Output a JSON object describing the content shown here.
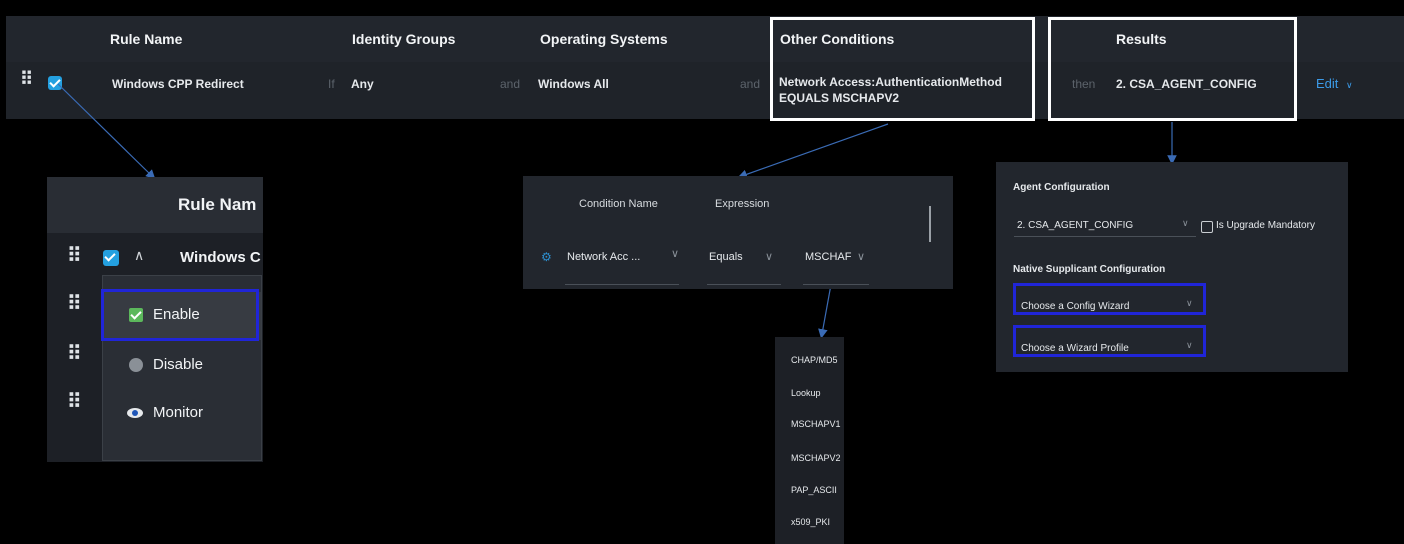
{
  "header": {
    "rule_name": "Rule Name",
    "identity_groups": "Identity Groups",
    "operating_systems": "Operating Systems",
    "other_conditions": "Other Conditions",
    "results": "Results"
  },
  "rule_row": {
    "name": "Windows CPP Redirect",
    "if_label": "If",
    "identity_group": "Any",
    "and1": "and",
    "os": "Windows All",
    "and2": "and",
    "condition_line1": "Network Access:AuthenticationMethod",
    "condition_line2": "EQUALS MSCHAPV2",
    "then_label": "then",
    "result": "2. CSA_AGENT_CONFIG",
    "edit": "Edit",
    "edit_chevron": "∨"
  },
  "rule_menu_panel": {
    "header": "Rule Nam",
    "row_name": "Windows C",
    "menu": {
      "enable": "Enable",
      "disable": "Disable",
      "monitor": "Monitor"
    }
  },
  "condition_panel": {
    "col_condition_name": "Condition Name",
    "col_expression": "Expression",
    "condition_value": "Network Acc ...",
    "operator_value": "Equals",
    "expression_value": "MSCHAF"
  },
  "auth_methods": [
    "CHAP/MD5",
    "Lookup",
    "MSCHAPV1",
    "MSCHAPV2",
    "PAP_ASCII",
    "x509_PKI"
  ],
  "agent_panel": {
    "agent_config_title": "Agent Configuration",
    "agent_config_value": "2. CSA_AGENT_CONFIG",
    "upgrade_label": "Is Upgrade Mandatory",
    "native_title": "Native Supplicant Configuration",
    "config_wizard_placeholder": "Choose a Config Wizard",
    "wizard_profile_placeholder": "Choose a Wizard Profile"
  },
  "colors": {
    "checkbox": "#24a0e0",
    "enable_check": "#5cb85c",
    "highlight_blue": "#2025d8",
    "edit_link": "#3c9be8",
    "arrow": "#3a6bb5"
  }
}
